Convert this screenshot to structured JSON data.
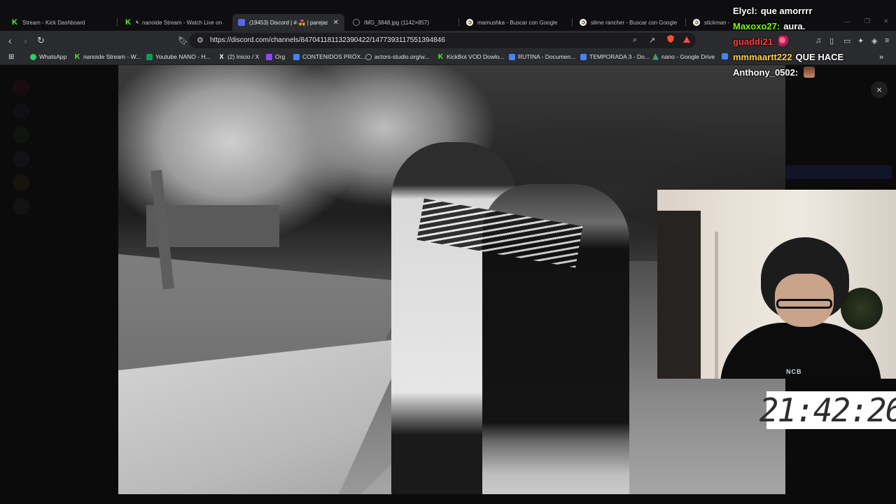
{
  "tabs": [
    {
      "title": "Stream - Kick Dashboard",
      "icon": "kick-icon",
      "active": false
    },
    {
      "title": "nanoide Stream - Watch Live on",
      "icon": "kick-icon",
      "active": false
    },
    {
      "title": "(19453) Discord | #·💑 | parejas",
      "icon": "discord-icon",
      "active": true
    },
    {
      "title": "IMG_3848.jpg (1142×857)",
      "icon": "image-icon",
      "active": false
    },
    {
      "title": "mamushka - Buscar con Google",
      "icon": "google-icon",
      "active": false
    },
    {
      "title": "slime rancher - Buscar con Google",
      "icon": "google-icon",
      "active": false
    },
    {
      "title": "stickman -",
      "icon": "google-icon",
      "active": false
    }
  ],
  "address_bar": {
    "url": "https://discord.com/channels/847041181132390422/1477393117551394846"
  },
  "bookmarks": [
    {
      "label": "WhatsApp",
      "icon": "whatsapp-icon"
    },
    {
      "label": "nanoide Stream - W...",
      "icon": "kick-icon"
    },
    {
      "label": "Youtube NANO - H...",
      "icon": "sheets-icon"
    },
    {
      "label": "(2) Inicio / X",
      "icon": "x-icon"
    },
    {
      "label": "Org",
      "icon": "twitch-icon"
    },
    {
      "label": "CONTENIDOS PRÓX...",
      "icon": "docs-icon"
    },
    {
      "label": "actors-studio.org/w...",
      "icon": "globe-icon"
    },
    {
      "label": "KickBot VOD Dowlo...",
      "icon": "kick-icon"
    },
    {
      "label": "RUTINA - Documen...",
      "icon": "docs-icon"
    },
    {
      "label": "TEMPORADA 3 - Do...",
      "icon": "docs-icon"
    },
    {
      "label": "nano - Google Drive",
      "icon": "drive-icon"
    }
  ],
  "chat": [
    {
      "user": "Elycl:",
      "message": "que amorrrr",
      "color": "#ffffff"
    },
    {
      "user": "Maxoxo27:",
      "message": "aura.",
      "color": "#7cfc00"
    },
    {
      "user": "guaddi21",
      "message": "",
      "color": "#ff3b3b",
      "emote": "heart-emote"
    },
    {
      "user": "mmmaartt222",
      "message": "QUE HACE",
      "color": "#ffd23a"
    },
    {
      "user": "Anthony_0502:",
      "message": "",
      "color": "#ffffff",
      "emote": "face-emote"
    }
  ],
  "clock": {
    "time": "21:42:26"
  },
  "viewer": {
    "close_symbol": "×"
  },
  "photo": {
    "description_alt": "IMG_3848.jpg"
  },
  "webcam": {
    "shirt_text": "NCB"
  }
}
